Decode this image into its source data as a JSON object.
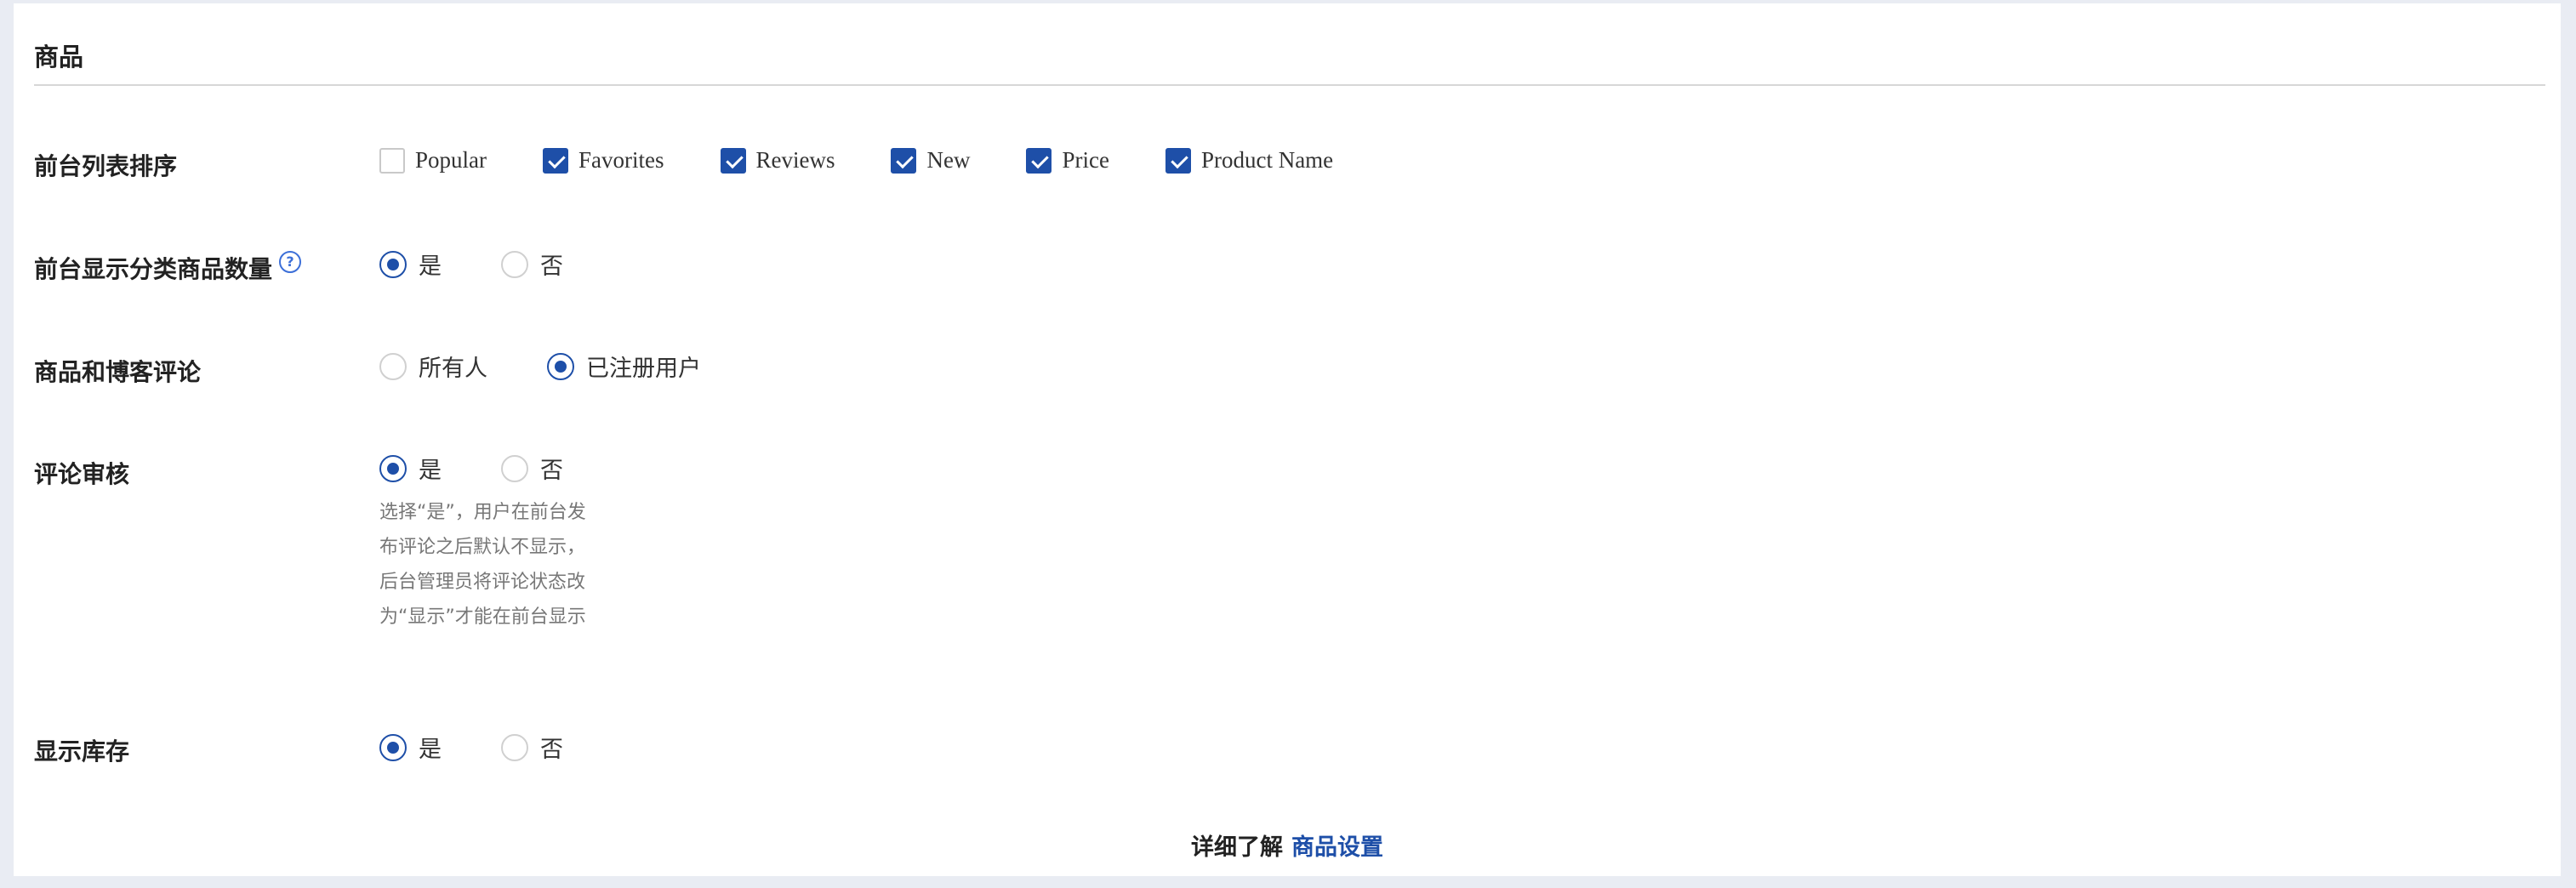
{
  "section": {
    "title": "商品"
  },
  "list_sort": {
    "label": "前台列表排序",
    "options": [
      {
        "label": "Popular",
        "checked": false
      },
      {
        "label": "Favorites",
        "checked": true
      },
      {
        "label": "Reviews",
        "checked": true
      },
      {
        "label": "New",
        "checked": true
      },
      {
        "label": "Price",
        "checked": true
      },
      {
        "label": "Product Name",
        "checked": true
      }
    ]
  },
  "category_count": {
    "label": "前台显示分类商品数量",
    "help_icon": "question-circle-icon",
    "options": [
      {
        "label": "是",
        "checked": true
      },
      {
        "label": "否",
        "checked": false
      }
    ]
  },
  "comments": {
    "label": "商品和博客评论",
    "options": [
      {
        "label": "所有人",
        "checked": false
      },
      {
        "label": "已注册用户",
        "checked": true
      }
    ]
  },
  "review_moderation": {
    "label": "评论审核",
    "options": [
      {
        "label": "是",
        "checked": true
      },
      {
        "label": "否",
        "checked": false
      }
    ],
    "help_text": "选择“是”，用户在前台发布评论之后默认不显示，后台管理员将评论状态改为“显示”才能在前台显示"
  },
  "show_stock": {
    "label": "显示库存",
    "options": [
      {
        "label": "是",
        "checked": true
      },
      {
        "label": "否",
        "checked": false
      }
    ]
  },
  "footer": {
    "prefix": "详细了解",
    "link": "商品设置"
  },
  "colors": {
    "accent": "#1e4fa8",
    "border": "#d7d7d7",
    "background": "#e9ecf3"
  }
}
